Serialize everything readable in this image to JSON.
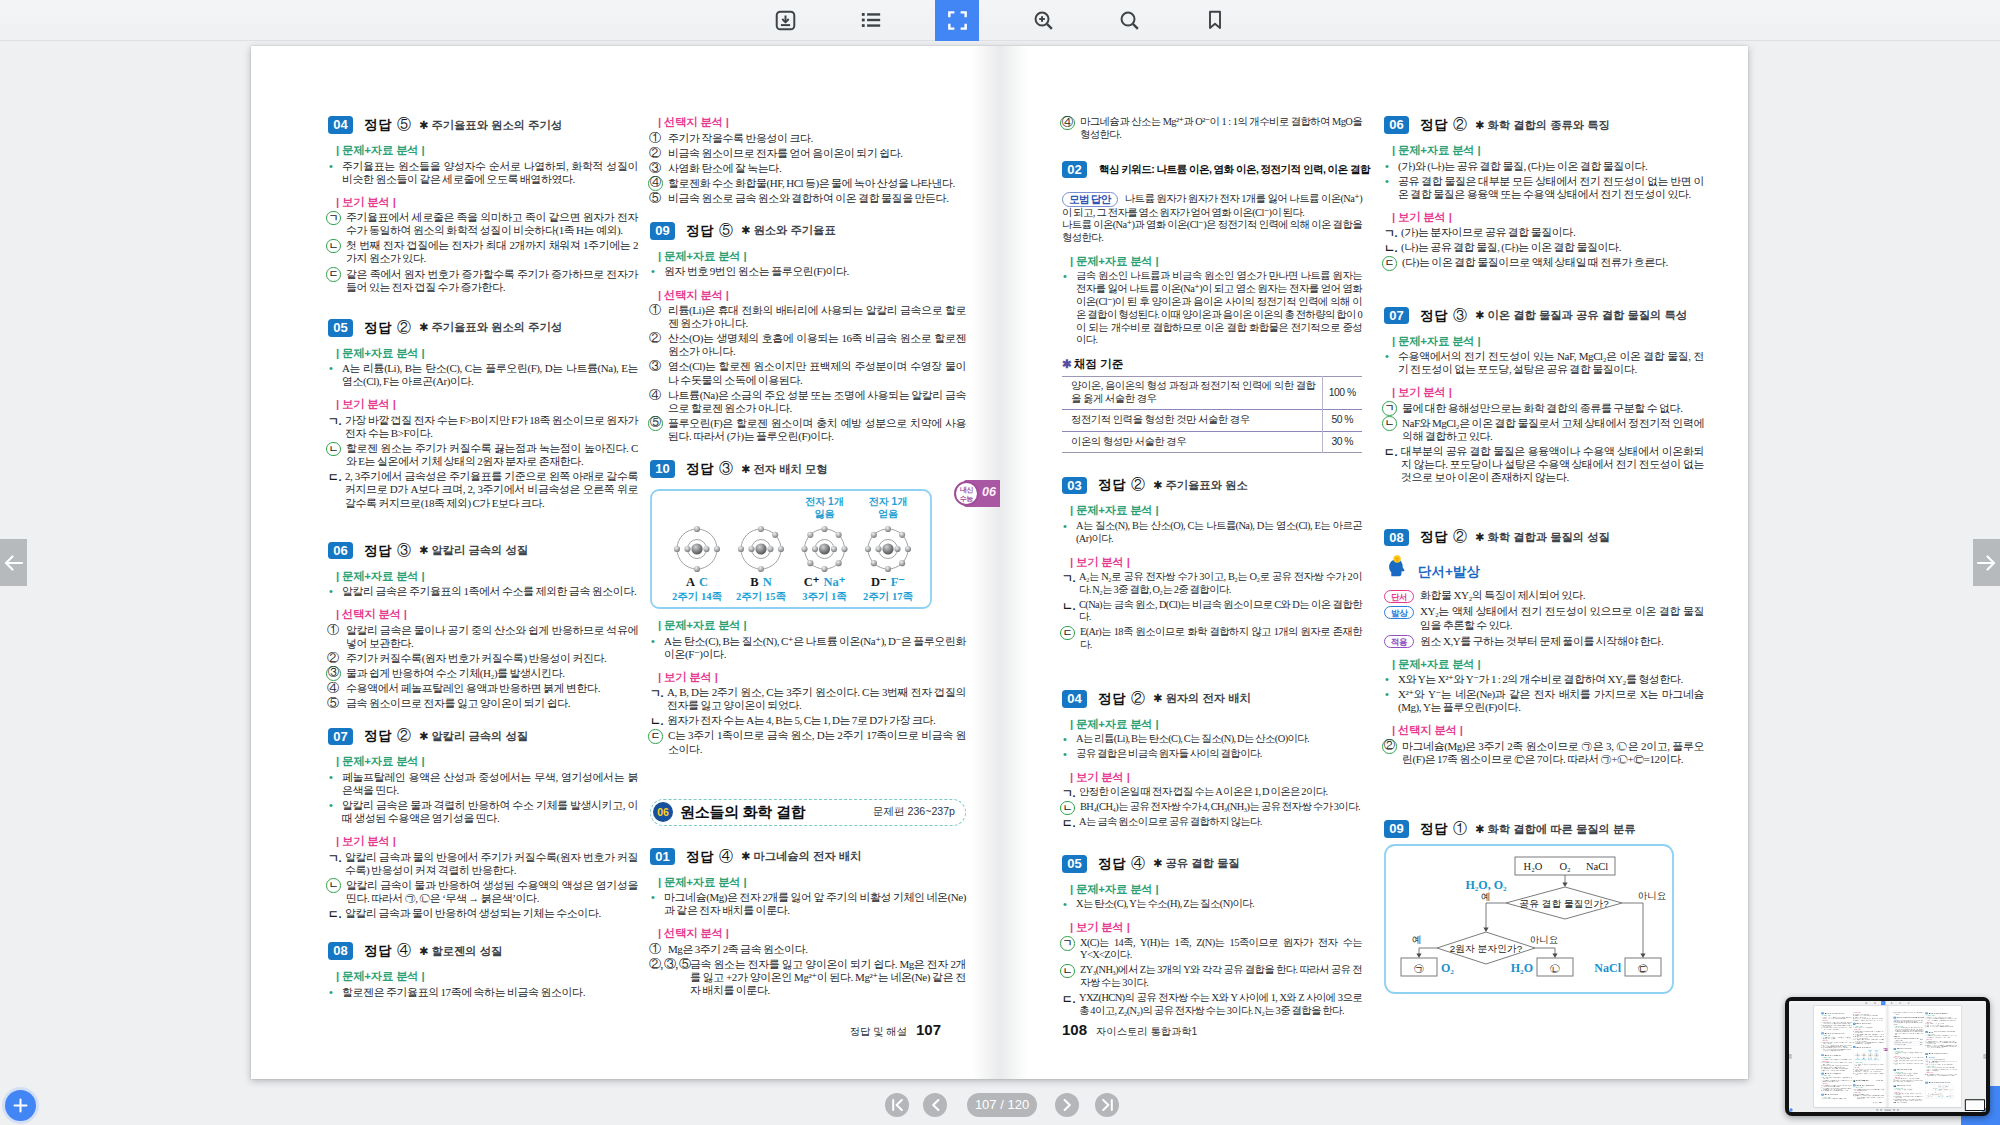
{
  "toolbar": {
    "buttons": [
      {
        "name": "download",
        "active": false
      },
      {
        "name": "toc",
        "active": false
      },
      {
        "name": "fullscreen",
        "active": true
      },
      {
        "name": "zoom-in",
        "active": false
      },
      {
        "name": "search",
        "active": false
      },
      {
        "name": "bookmark",
        "active": false
      }
    ]
  },
  "pager": {
    "label": "107 / 120"
  },
  "labels": {
    "answer": "정답"
  },
  "accent": {
    "active_blue": "#4285f4",
    "problem_blue": "#1677c4",
    "green": "#29a173",
    "pink": "#e73b90",
    "purple_tab": "#a957a2",
    "figure_blue": "#1d9fd4"
  },
  "book": {
    "left_footer": {
      "label": "정답 및 해설",
      "page": "107"
    },
    "right_footer": {
      "page": "108",
      "label": "자이스토리 통합과학1"
    },
    "edge_tab": {
      "line1": "내신",
      "line2": "수능",
      "num": "06"
    },
    "columns": [
      [
        {
          "t": "p",
          "n": "04",
          "a": "⑤",
          "s": "주기율표와 원소의 주기성"
        },
        {
          "t": "h",
          "c": "g",
          "x": "문제+자료 분석"
        },
        {
          "t": "i",
          "m": "•",
          "x": "주기율표는 원소들을 양성자수 순서로 나열하되, 화학적 성질이 비슷한 원소들이 같은 세로줄에 오도록 배열하였다."
        },
        {
          "t": "h",
          "c": "p",
          "x": "보기 분석"
        },
        {
          "t": "i",
          "m": "ㄱ",
          "r": 1,
          "x": "주기율표에서 세로줄은 족을 의미하고 족이 같으면 원자가 전자 수가 동일하여 원소의 화학적 성질이 비슷하다(1족 H는 예외)."
        },
        {
          "t": "i",
          "m": "ㄴ",
          "r": 1,
          "x": "첫 번째 전자 껍질에는 전자가 최대 2개까지 채워져 1주기에는 2가지 원소가 있다."
        },
        {
          "t": "i",
          "m": "ㄷ",
          "r": 1,
          "x": "같은 족에서 원자 번호가 증가할수록 주기가 증가하므로 전자가 들어 있는 전자 껍질 수가 증가한다."
        },
        {
          "t": "sp",
          "h": 8
        },
        {
          "t": "p",
          "n": "05",
          "a": "②",
          "s": "주기율표와 원소의 주기성"
        },
        {
          "t": "h",
          "c": "g",
          "x": "문제+자료 분석"
        },
        {
          "t": "i",
          "m": "•",
          "x": "A는 리튬(Li), B는 탄소(C), C는 플루오린(F), D는 나트륨(Na), E는 염소(Cl), F는 아르곤(Ar)이다."
        },
        {
          "t": "h",
          "c": "p",
          "x": "보기 분석"
        },
        {
          "t": "i",
          "m": "ㄱ.",
          "x": "가장 바깥 껍질 전자 수는 F>B이지만 F가 18족 원소이므로 원자가 전자 수는 B>F이다."
        },
        {
          "t": "i",
          "m": "ㄴ",
          "r": 1,
          "x": "할로젠 원소는 주기가 커질수록 끓는점과 녹는점이 높아진다. C와 E는 실온에서 기체 상태의 2원자 분자로 존재한다."
        },
        {
          "t": "i",
          "m": "ㄷ.",
          "x": "2, 3주기에서 금속성은 주기율표를 기준으로 왼쪽 아래로 갈수록 커지므로 D가 A보다 크며, 2, 3주기에서 비금속성은 오른쪽 위로 갈수록 커지므로(18족 제외) C가 E보다 크다."
        },
        {
          "t": "sp",
          "h": 15
        },
        {
          "t": "p",
          "n": "06",
          "a": "③",
          "s": "알칼리 금속의 성질"
        },
        {
          "t": "h",
          "c": "g",
          "x": "문제+자료 분석"
        },
        {
          "t": "i",
          "m": "•",
          "x": "알칼리 금속은 주기율표의 1족에서 수소를 제외한 금속 원소이다."
        },
        {
          "t": "h",
          "c": "p",
          "x": "선택지 분석"
        },
        {
          "t": "i",
          "m": "①",
          "x": "알칼리 금속은 물이나 공기 중의 산소와 쉽게 반응하므로 석유에 넣어 보관한다."
        },
        {
          "t": "i",
          "m": "②",
          "x": "주기가 커질수록(원자 번호가 커질수록) 반응성이 커진다."
        },
        {
          "t": "i",
          "m": "③",
          "r": 1,
          "x": "물과 쉽게 반응하여 수소 기체(H₂)를 발생시킨다."
        },
        {
          "t": "i",
          "m": "④",
          "x": "수용액에서 페놀프탈레인 용액과 반응하면 붉게 변한다."
        },
        {
          "t": "i",
          "m": "⑤",
          "x": "금속 원소이므로 전자를 잃고 양이온이 되기 쉽다."
        },
        {
          "t": "p",
          "n": "07",
          "a": "②",
          "s": "알칼리 금속의 성질"
        },
        {
          "t": "h",
          "c": "g",
          "x": "문제+자료 분석"
        },
        {
          "t": "i",
          "m": "•",
          "x": "페놀프탈레인 용액은 산성과 중성에서는 무색, 염기성에서는 붉은색을 띤다."
        },
        {
          "t": "i",
          "m": "•",
          "x": "알칼리 금속은 물과 격렬히 반응하여 수소 기체를 발생시키고, 이때 생성된 수용액은 염기성을 띤다."
        },
        {
          "t": "h",
          "c": "p",
          "x": "보기 분석"
        },
        {
          "t": "i",
          "m": "ㄱ.",
          "x": "알칼리 금속과 물의 반응에서 주기가 커질수록(원자 번호가 커질수록) 반응성이 커져 격렬히 반응한다."
        },
        {
          "t": "i",
          "m": "ㄴ",
          "r": 1,
          "x": "알칼리 금속이 물과 반응하여 생성된 수용액의 액성은 염기성을 띤다. 따라서 ㉠, ㉡은 ‘무색 → 붉은색’이다."
        },
        {
          "t": "i",
          "m": "ㄷ.",
          "x": "알칼리 금속과 물이 반응하여 생성되는 기체는 수소이다."
        },
        {
          "t": "sp",
          "h": 5
        },
        {
          "t": "p",
          "n": "08",
          "a": "④",
          "s": "할로젠의 성질"
        },
        {
          "t": "h",
          "c": "g",
          "x": "문제+자료 분석"
        },
        {
          "t": "i",
          "m": "•",
          "x": "할로젠은 주기율표의 17족에 속하는 비금속 원소이다."
        }
      ],
      [
        {
          "t": "h",
          "c": "p",
          "x": "선택지 분석"
        },
        {
          "t": "i",
          "m": "①",
          "x": "주기가 작을수록 반응성이 크다."
        },
        {
          "t": "i",
          "m": "②",
          "x": "비금속 원소이므로 전자를 얻어 음이온이 되기 쉽다."
        },
        {
          "t": "i",
          "m": "③",
          "x": "사염화 탄소에 잘 녹는다."
        },
        {
          "t": "i",
          "m": "④",
          "r": 1,
          "x": "할로젠화 수소 화합물(HF, HCl 등)은 물에 녹아 산성을 나타낸다."
        },
        {
          "t": "i",
          "m": "⑤",
          "x": "비금속 원소로 금속 원소와 결합하여 이온 결합 물질을 만든다."
        },
        {
          "t": "p",
          "n": "09",
          "a": "⑤",
          "s": "원소와 주기율표"
        },
        {
          "t": "h",
          "c": "g",
          "x": "문제+자료 분석"
        },
        {
          "t": "i",
          "m": "•",
          "x": "원자 번호 9번인 원소는 플루오린(F)이다."
        },
        {
          "t": "h",
          "c": "p",
          "x": "선택지 분석"
        },
        {
          "t": "i",
          "m": "①",
          "x": "리튬(Li)은 휴대 전화의 배터리에 사용되는 알칼리 금속으로 할로젠 원소가 아니다."
        },
        {
          "t": "i",
          "m": "②",
          "x": "산소(O)는 생명체의 호흡에 이용되는 16족 비금속 원소로 할로젠 원소가 아니다."
        },
        {
          "t": "i",
          "m": "③",
          "x": "염소(Cl)는 할로젠 원소이지만 표백제의 주성분이며 수영장 물이나 수돗물의 소독에 이용된다."
        },
        {
          "t": "i",
          "m": "④",
          "x": "나트륨(Na)은 소금의 주요 성분 또는 조명에 사용되는 알칼리 금속으로 할로젠 원소가 아니다."
        },
        {
          "t": "i",
          "m": "⑤",
          "r": 1,
          "x": "플루오린(F)은 할로젠 원소이며 충치 예방 성분으로 치약에 사용된다. 따라서 (가)는 플루오린(F)이다."
        },
        {
          "t": "p",
          "n": "10",
          "a": "③",
          "s": "전자 배치 모형"
        },
        {
          "t": "atoms",
          "cells": [
            {
              "k": "A",
              "v": "C",
              "g": "2주기 14족",
              "e": 4
            },
            {
              "k": "B",
              "v": "N",
              "g": "2주기 15족",
              "e": 5
            },
            {
              "k": "C⁺",
              "v": "Na⁺",
              "g": "3주기 1족",
              "e": 8,
              "cap1": "전자 1개",
              "cap2": "잃음"
            },
            {
              "k": "D⁻",
              "v": "F⁻",
              "g": "2주기 17족",
              "e": 8,
              "cap1": "전자 1개",
              "cap2": "얻음"
            }
          ]
        },
        {
          "t": "h",
          "c": "g",
          "x": "문제+자료 분석"
        },
        {
          "t": "i",
          "m": "•",
          "x": "A는 탄소(C), B는 질소(N), C⁺은 나트륨 이온(Na⁺), D⁻은 플루오린화 이온(F⁻)이다."
        },
        {
          "t": "h",
          "c": "p",
          "x": "보기 분석"
        },
        {
          "t": "i",
          "m": "ㄱ.",
          "x": "A, B, D는 2주기 원소, C는 3주기 원소이다. C는 3번째 전자 껍질의 전자를 잃고 양이온이 되었다."
        },
        {
          "t": "i",
          "m": "ㄴ.",
          "x": "원자가 전자 수는 A는 4, B는 5, C는 1, D는 7로 D가 가장 크다."
        },
        {
          "t": "i",
          "m": "ㄷ",
          "r": 1,
          "x": "C는 3주기 1족이므로 금속 원소, D는 2주기 17족이므로 비금속 원소이다."
        },
        {
          "t": "sp",
          "h": 26
        },
        {
          "t": "u",
          "badge": "06",
          "title": "원소들의 화학 결합",
          "ref": "문제편 236~237p"
        },
        {
          "t": "sp",
          "h": 5
        },
        {
          "t": "p",
          "n": "01",
          "a": "④",
          "s": "마그네슘의 전자 배치"
        },
        {
          "t": "h",
          "c": "g",
          "x": "문제+자료 분석"
        },
        {
          "t": "i",
          "m": "•",
          "x": "마그네슘(Mg)은 전자 2개를 잃어 앞 주기의 비활성 기체인 네온(Ne)과 같은 전자 배치를 이룬다."
        },
        {
          "t": "h",
          "c": "p",
          "x": "선택지 분석"
        },
        {
          "t": "i",
          "m": "①",
          "x": "Mg은 3주기 2족 금속 원소이다."
        },
        {
          "t": "i",
          "m": "②, ③, ⑤",
          "w": 1,
          "x": "금속 원소는 전자를 잃고 양이온이 되기 쉽다. Mg은 전자 2개를 잃고 +2가 양이온인 Mg²⁺이 된다. Mg²⁺는 네온(Ne) 같은 전자 배치를 이룬다."
        }
      ],
      [
        {
          "t": "i",
          "m": "④",
          "r": 1,
          "x": "마그네슘과 산소는 Mg²⁺과 O²⁻이 1 : 1의 개수비로 결합하여 MgO을 형성한다."
        },
        {
          "t": "sp",
          "h": 2
        },
        {
          "t": "p",
          "n": "02",
          "kw": "핵심 키워드: 나트륨 이온, 염화 이온, 정전기적 인력, 이온 결합"
        },
        {
          "t": "m",
          "label": "모범 답안",
          "x": "나트륨 원자가 원자가 전자 1개를 잃어 나트륨 이온(Na⁺)이 되고, 그 전자를 염소 원자가 얻어 염화 이온(Cl⁻)이 된다.\n나트륨 이온(Na⁺)과 염화 이온(Cl⁻)은 정전기적 인력에 의해 이온 결합을 형성한다."
        },
        {
          "t": "h",
          "c": "g",
          "x": "문제+자료 분석"
        },
        {
          "t": "i",
          "m": "•",
          "x": "금속 원소인 나트륨과 비금속 원소인 염소가 만나면 나트륨 원자는 전자를 잃어 나트륨 이온(Na⁺)이 되고 염소 원자는 전자를 얻어 염화 이온(Cl⁻)이 된 후 양이온과 음이온 사이의 정전기적 인력에 의해 이온 결합이 형성된다. 이때 양이온과 음이온 이온의 총 전하량의 합이 0이 되는 개수비로 결합하므로 이온 결합 화합물은 전기적으로 중성이다."
        },
        {
          "t": "tbl",
          "cap": "채점 기준",
          "rows": [
            [
              "양이온, 음이온의 형성 과정과 정전기적 인력에 의한 결합을 옳게 서술한 경우",
              "100 %"
            ],
            [
              "정전기적 인력을 형성한 것만 서술한 경우",
              "50 %"
            ],
            [
              "이온의 형성만 서술한 경우",
              "30 %"
            ]
          ]
        },
        {
          "t": "sp",
          "h": 6
        },
        {
          "t": "p",
          "n": "03",
          "a": "②",
          "s": "주기율표와 원소"
        },
        {
          "t": "h",
          "c": "g",
          "x": "문제+자료 분석"
        },
        {
          "t": "i",
          "m": "•",
          "x": "A는 질소(N), B는 산소(O), C는 나트륨(Na), D는 염소(Cl), E는 아르곤(Ar)이다."
        },
        {
          "t": "h",
          "c": "p",
          "x": "보기 분석"
        },
        {
          "t": "i",
          "m": "ㄱ.",
          "x": "A₂는 N₂로 공유 전자쌍 수가 3이고, B₂는 O₂로 공유 전자쌍 수가 2이다. N₂는 3중 결합, O₂는 2중 결합이다."
        },
        {
          "t": "i",
          "m": "ㄴ.",
          "x": "C(Na)는 금속 원소, D(Cl)는 비금속 원소이므로 C와 D는 이온 결합한다."
        },
        {
          "t": "i",
          "m": "ㄷ",
          "r": 1,
          "x": "E(Ar)는 18족 원소이므로 화학 결합하지 않고 1개의 원자로 존재한다."
        },
        {
          "t": "sp",
          "h": 21
        },
        {
          "t": "p",
          "n": "04",
          "a": "②",
          "s": "원자의 전자 배치"
        },
        {
          "t": "h",
          "c": "g",
          "x": "문제+자료 분석"
        },
        {
          "t": "i",
          "m": "•",
          "x": "A는 리튬(Li), B는 탄소(C), C는 질소(N), D는 산소(O)이다."
        },
        {
          "t": "i",
          "m": "•",
          "x": "공유 결합은 비금속 원자들 사이의 결합이다."
        },
        {
          "t": "h",
          "c": "p",
          "x": "보기 분석"
        },
        {
          "t": "i",
          "m": "ㄱ.",
          "x": "안정한 이온일 때 전자 껍질 수는 A 이온은 1, D 이온은 2이다."
        },
        {
          "t": "i",
          "m": "ㄴ",
          "r": 1,
          "x": "BH₄(CH₄)는 공유 전자쌍 수가 4, CH₃(NH₃)는 공유 전자쌍 수가 3이다."
        },
        {
          "t": "i",
          "m": "ㄷ.",
          "x": "A는 금속 원소이므로 공유 결합하지 않는다."
        },
        {
          "t": "sp",
          "h": 9
        },
        {
          "t": "p",
          "n": "05",
          "a": "④",
          "s": "공유 결합 물질"
        },
        {
          "t": "h",
          "c": "g",
          "x": "문제+자료 분석"
        },
        {
          "t": "i",
          "m": "•",
          "x": "X는 탄소(C), Y는 수소(H), Z는 질소(N)이다."
        },
        {
          "t": "h",
          "c": "p",
          "x": "보기 분석"
        },
        {
          "t": "i",
          "m": "ㄱ",
          "r": 1,
          "x": "X(C)는 14족, Y(H)는 1족, Z(N)는 15족이므로 원자가 전자 수는 Y<X<Z이다."
        },
        {
          "t": "i",
          "m": "ㄴ",
          "r": 1,
          "x": "ZY₃(NH₃)에서 Z는 3개의 Y와 각각 공유 결합을 한다. 따라서 공유 전자쌍 수는 3이다."
        },
        {
          "t": "i",
          "m": "ㄷ.",
          "x": "YXZ(HCN)의 공유 전자쌍 수는 X와 Y 사이에 1, X와 Z 사이에 3으로 총 4이고, Z₂(N₂)의 공유 전자쌍 수는 3이다. N₂는 3중 결합을 한다."
        }
      ],
      [
        {
          "t": "p",
          "n": "06",
          "a": "②",
          "s": "화학 결합의 종류와 특징"
        },
        {
          "t": "h",
          "c": "g",
          "x": "문제+자료 분석"
        },
        {
          "t": "i",
          "m": "•",
          "x": "(가)와 (나)는 공유 결합 물질, (다)는 이온 결합 물질이다."
        },
        {
          "t": "i",
          "m": "•",
          "x": "공유 결합 물질은 대부분 모든 상태에서 전기 전도성이 없는 반면 이온 결합 물질은 용융액 또는 수용액 상태에서 전기 전도성이 있다."
        },
        {
          "t": "h",
          "c": "p",
          "x": "보기 분석"
        },
        {
          "t": "i",
          "m": "ㄱ.",
          "x": "(가)는 분자이므로 공유 결합 물질이다."
        },
        {
          "t": "i",
          "m": "ㄴ.",
          "x": "(나)는 공유 결합 물질, (다)는 이온 결합 물질이다."
        },
        {
          "t": "i",
          "m": "ㄷ",
          "r": 1,
          "x": "(다)는 이온 결합 물질이므로 액체 상태일 때 전류가 흐른다."
        },
        {
          "t": "sp",
          "h": 20
        },
        {
          "t": "p",
          "n": "07",
          "a": "③",
          "s": "이온 결합 물질과 공유 결합 물질의 특성"
        },
        {
          "t": "h",
          "c": "g",
          "x": "문제+자료 분석"
        },
        {
          "t": "i",
          "m": "•",
          "x": "수용액에서의 전기 전도성이 있는 NaF, MgCl₂은 이온 결합 물질, 전기 전도성이 없는 포도당, 설탕은 공유 결합 물질이다."
        },
        {
          "t": "h",
          "c": "p",
          "x": "보기 분석"
        },
        {
          "t": "i",
          "m": "ㄱ",
          "r": 1,
          "x": "물에 대한 용해성만으로는 화학 결합의 종류를 구분할 수 없다."
        },
        {
          "t": "i",
          "m": "ㄴ",
          "r": 1,
          "x": "NaF와 MgCl₂은 이온 결합 물질로서 고체 상태에서 정전기적 인력에 의해 결합하고 있다."
        },
        {
          "t": "i",
          "m": "ㄷ.",
          "x": "대부분의 공유 결합 물질은 용융액이나 수용액 상태에서 이온화되지 않는다. 포도당이나 설탕은 수용액 상태에서 전기 전도성이 없는 것으로 보아 이온이 존재하지 않는다."
        },
        {
          "t": "sp",
          "h": 27
        },
        {
          "t": "p",
          "n": "08",
          "a": "②",
          "s": "화학 결합과 물질의 성질"
        },
        {
          "t": "clue",
          "title": "단서+발상",
          "items": [
            [
              "단서",
              "화합물 XY₂의 특징이 제시되어 있다."
            ],
            [
              "발상",
              "XY₂는 액체 상태에서 전기 전도성이 있으므로 이온 결합 물질임을 추론할 수 있다."
            ],
            [
              "적용",
              "원소 X,Y를 구하는 것부터 문제 풀이를 시작해야 한다."
            ]
          ]
        },
        {
          "t": "h",
          "c": "g",
          "x": "문제+자료 분석"
        },
        {
          "t": "i",
          "m": "•",
          "x": "X와 Y는 X²⁺와 Y⁻가 1 : 2의 개수비로 결합하여 XY₂를 형성한다."
        },
        {
          "t": "i",
          "m": "•",
          "x": "X²⁺와 Y⁻는 네온(Ne)과 같은 전자 배치를 가지므로 X는 마그네슘(Mg), Y는 플루오린(F)이다."
        },
        {
          "t": "h",
          "c": "p",
          "x": "선택지 분석"
        },
        {
          "t": "i",
          "m": "②",
          "r": 1,
          "x": "마그네슘(Mg)은 3주기 2족 원소이므로 ㉠은 3, ㉡은 2이고, 플루오린(F)은 17족 원소이므로 ㉢은 7이다. 따라서 ㉠+㉡+㉢=12이다."
        },
        {
          "t": "sp",
          "h": 37
        },
        {
          "t": "p",
          "n": "09",
          "a": "①",
          "s": "화학 결합에 따른 물질의 분류"
        },
        {
          "t": "flow",
          "src": [
            "H₂O",
            "O₂",
            "NaCl"
          ],
          "q1": "공유 결합 물질인가?",
          "q2": "2원자 분자인가?",
          "yes": "예",
          "no": "아니요",
          "path_label": "H₂O, O₂",
          "b1": "㉠",
          "b1x": "O₂",
          "b2": "㉡",
          "b2x": "H₂O",
          "b3": "㉢",
          "b3x": "NaCl"
        }
      ]
    ]
  }
}
